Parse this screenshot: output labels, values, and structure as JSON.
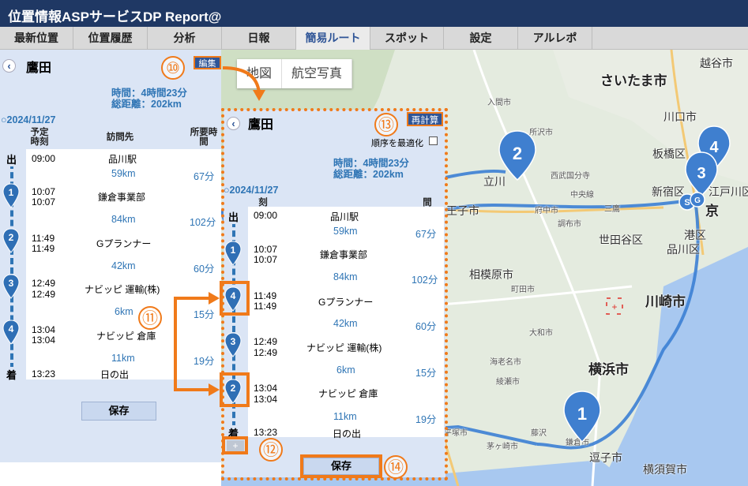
{
  "app": {
    "title": "位置情報ASPサービスDP Report@"
  },
  "menu": [
    {
      "label": "最新位置"
    },
    {
      "label": "位置履歴"
    },
    {
      "label": "分析"
    },
    {
      "label": "日報"
    },
    {
      "label": "簡易ルート"
    },
    {
      "label": "スポット"
    },
    {
      "label": "設定"
    },
    {
      "label": "アルレポ"
    }
  ],
  "map": {
    "tabs": [
      "地図",
      "航空写真"
    ],
    "labels": {
      "saitama": "さいたま市",
      "kawaguchi": "川口市",
      "itabashi": "板橋区",
      "shinjuku": "新宿区",
      "edogawa": "江戸川区",
      "tokyo": "京",
      "minato": "港区",
      "shinagawa": "品川区",
      "setagaya": "世田谷区",
      "kawasaki": "川崎市",
      "sagamihara": "相模原市",
      "yokohama": "横浜市",
      "koshigaya": "越谷市",
      "tachikawa": "立川",
      "ouji": "王子市",
      "zushi": "逗子市",
      "yokosuka": "横須賀市",
      "tokorozawa": "所沢市",
      "chofu": "調布市",
      "fuchu": "府中市",
      "mitaka": "三鷹",
      "iruma": "入間市",
      "kokubunji": "西武国分寺",
      "chuosen": "中央線",
      "machida": "町田市",
      "yamato": "大和市",
      "ebina": "海老名市",
      "ayase": "綾瀬市",
      "hiratsuka": "平塚市",
      "chigasaki": "茅ヶ崎市",
      "fujisawa": "藤沢",
      "kamakura": "鎌倉市"
    },
    "pin_labels": [
      "2",
      "3",
      "4",
      "1",
      "S",
      "G"
    ]
  },
  "left_panel": {
    "back": "‹",
    "name": "鷹田",
    "edit_label": "編集",
    "time_label": "時間：4時間23分",
    "distance_label": "総距離：202km",
    "date": "○2024/11/27",
    "col_planned": "予定時刻",
    "col_visit": "訪問先",
    "col_duration": "所要時間",
    "rows": [
      {
        "mark": "出",
        "t1": "09:00",
        "t2": "",
        "place": "品川駅"
      },
      {
        "mark": "1",
        "t1": "10:07",
        "t2": "10:07",
        "place": "鎌倉事業部"
      },
      {
        "mark": "2",
        "t1": "11:49",
        "t2": "11:49",
        "place": "Gプランナー"
      },
      {
        "mark": "3",
        "t1": "12:49",
        "t2": "12:49",
        "place": "ナビッピ 運輸(株)"
      },
      {
        "mark": "4",
        "t1": "13:04",
        "t2": "13:04",
        "place": "ナビッピ 倉庫"
      },
      {
        "mark": "着",
        "t1": "13:23",
        "t2": "",
        "place": "日の出"
      }
    ],
    "legs": [
      {
        "dist": "59km",
        "time": "67分"
      },
      {
        "dist": "84km",
        "time": "102分"
      },
      {
        "dist": "42km",
        "time": "60分"
      },
      {
        "dist": "6km",
        "time": "15分"
      },
      {
        "dist": "11km",
        "time": "19分"
      }
    ],
    "save_label": "保存"
  },
  "right_panel": {
    "back": "‹",
    "name": "鷹田",
    "recalc_label": "再計算",
    "optimize_label": "順序を最適化",
    "time_label": "時間：4時間23分",
    "distance_label": "総距離：202km",
    "date": "○2024/11/27",
    "col_planned_frag": "刻",
    "col_duration_frag": "間",
    "rows": [
      {
        "mark": "出",
        "t1": "09:00",
        "t2": "",
        "place": "品川駅"
      },
      {
        "mark": "1",
        "t1": "10:07",
        "t2": "10:07",
        "place": "鎌倉事業部"
      },
      {
        "mark": "4",
        "t1": "11:49",
        "t2": "11:49",
        "place": "Gプランナー"
      },
      {
        "mark": "3",
        "t1": "12:49",
        "t2": "12:49",
        "place": "ナビッピ 運輸(株)"
      },
      {
        "mark": "2",
        "t1": "13:04",
        "t2": "13:04",
        "place": "ナビッピ 倉庫"
      },
      {
        "mark": "着",
        "t1": "13:23",
        "t2": "",
        "place": "日の出"
      }
    ],
    "legs": [
      {
        "dist": "59km",
        "time": "67分"
      },
      {
        "dist": "84km",
        "time": "102分"
      },
      {
        "dist": "42km",
        "time": "60分"
      },
      {
        "dist": "6km",
        "time": "15分"
      },
      {
        "dist": "11km",
        "time": "19分"
      }
    ],
    "add_label": "+",
    "save_label": "保存"
  },
  "annotations": {
    "n10": "⑩",
    "n11": "⑪",
    "n12": "⑫",
    "n13": "⑬",
    "n14": "⑭"
  },
  "colors": {
    "header": "#1f3864",
    "accent": "#2f75b5",
    "annotation": "#f07a1a",
    "pin": "#2f6fb5",
    "route": "#3b7fd4"
  }
}
